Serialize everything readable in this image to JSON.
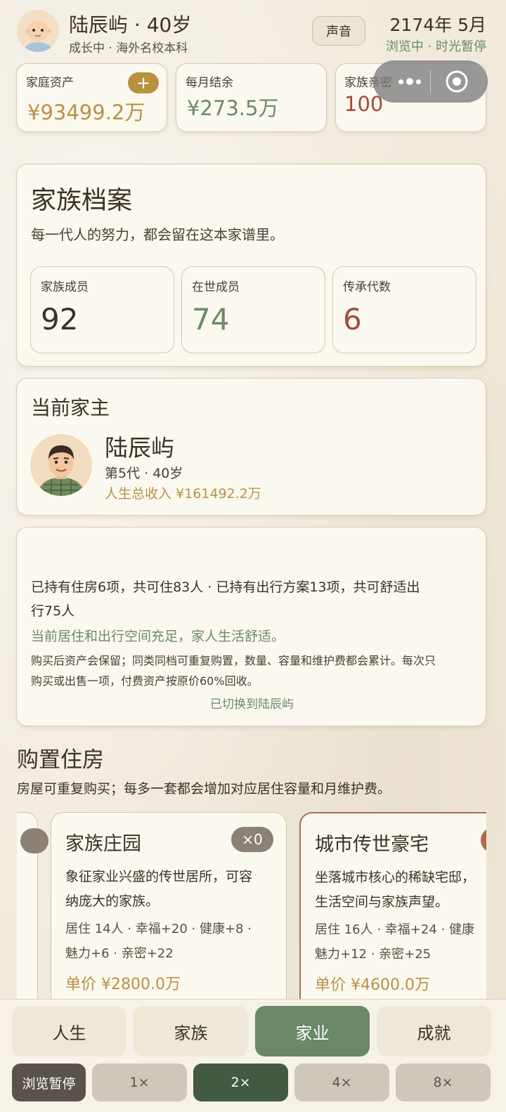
{
  "header": {
    "title": "陆辰屿 · 40岁",
    "subtitle": "成长中 · 海外名校本科",
    "sound_button": "声音",
    "date": "2174年 5月",
    "status": "浏览中 · 时光暂停"
  },
  "stats": {
    "assets_label": "家庭资产",
    "assets_value": "¥93499.2万",
    "add_label": "+",
    "monthly_label": "每月结余",
    "monthly_value": "¥273.5万",
    "intimacy_label": "家族亲密",
    "intimacy_value": "100"
  },
  "archive": {
    "title": "家族档案",
    "desc": "每一代人的努力，都会留在这本家谱里。",
    "members_label": "家族成员",
    "members_value": "92",
    "alive_label": "在世成员",
    "alive_value": "74",
    "generations_label": "传承代数",
    "generations_value": "6"
  },
  "head": {
    "title": "当前家主",
    "name": "陆辰屿",
    "meta": "第5代 · 40岁",
    "income": "人生总收入 ¥161492.2万"
  },
  "summary": {
    "line1": "已持有住房6项，共可住83人 · 已持有出行方案13项，共可舒适出",
    "line2": "行75人",
    "green": "当前居住和出行空间充足，家人生活舒适。",
    "note1": "购买后资产会保留；同类同档可重复购置，数量、容量和维护费都会累计。每次只",
    "note2": "购买或出售一项，付费资产按原价60%回收。",
    "switched": "已切换到陆辰屿"
  },
  "housing": {
    "title": "购置住房",
    "desc": "房屋可重复购买；每多一套都会增加对应居住容量和月维护费。",
    "cards": [
      {
        "name": "家族庄园",
        "count": "×0",
        "desc1": "象征家业兴盛的传世居所，可容",
        "desc2": "纳庞大的家族。",
        "effect1": "居住 14人 · 幸福+20 · 健康+8 ·",
        "effect2": "魅力+6 · 亲密+22",
        "price": "单价 ¥2800.0万"
      },
      {
        "name": "城市传世豪宅",
        "desc1": "坐落城市核心的稀缺宅邸，",
        "desc2": "生活空间与家族声望。",
        "effect1": "居住 16人 · 幸福+24 · 健康",
        "effect2": "魅力+12 · 亲密+25",
        "price": "单价 ¥4600.0万"
      }
    ]
  },
  "tabs": [
    "人生",
    "家族",
    "家业",
    "成就"
  ],
  "speed": {
    "pause": "浏览暂停",
    "options": [
      "1×",
      "2×",
      "4×",
      "8×"
    ]
  },
  "colors": {
    "accent_green": "#6a8767",
    "accent_gold": "#b89247",
    "accent_rust": "#a24e3b"
  }
}
